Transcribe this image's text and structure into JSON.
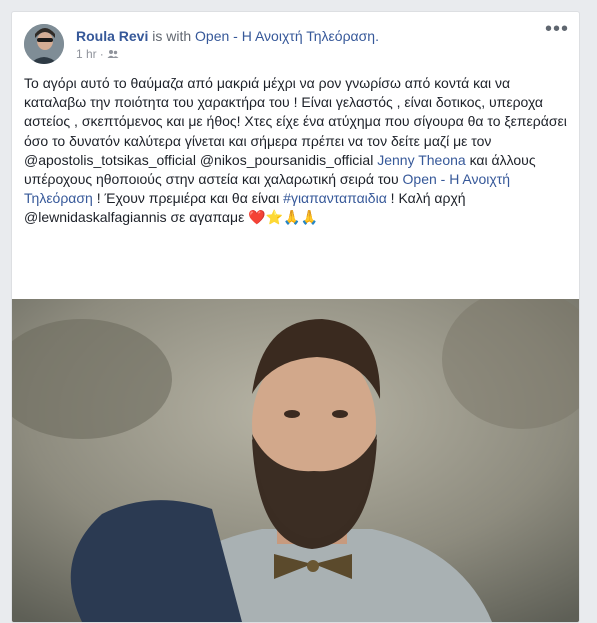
{
  "post": {
    "author": "Roula Revi",
    "with_text": "is with",
    "tagged_page": "Open - Η Ανοιχτή Τηλεόραση.",
    "time": "1 hr",
    "dot": "·",
    "audience_icon": "group-icon",
    "more_label": "•••"
  },
  "text": {
    "line1": "Το αγόρι αυτό το θαύμαζα από μακριά μέχρι να ρον γνωρίσω από κοντά και να καταλαβω την ποιότητα του χαρακτήρα του ! Είναι γελαστός , είναι δοτικος, υπεροχα αστείος , σκεπτόμενος και με ήθος! Χτες είχε ένα ατύχημα που σίγουρα θα το ξεπεράσει όσο το δυνατόν καλύτερα γίνεται και σήμερα πρέπει να τον δείτε μαζί με τον @apostolis_totsikas_official @nikos_poursanidis_official ",
    "mention_jenny": "Jenny Theona",
    "part2": " και άλλους υπέροχους ηθοποιούς στην αστεία και χαλαρωτική σειρά του ",
    "mention_open": "Open - Η Ανοιχτή Τηλεόραση",
    "part3": " ! Έχουν πρεμιέρα και θα είναι ",
    "hashtag": "#γιαπανταπαιδια",
    "part4": " ! Καλή αρχή @lewnidaskalfagiannis σε αγαπαμε ",
    "emojis": "❤️⭐🙏🙏"
  },
  "colors": {
    "link": "#365899",
    "text": "#1d2129",
    "meta": "#90949c",
    "background": "#e9ebee"
  }
}
